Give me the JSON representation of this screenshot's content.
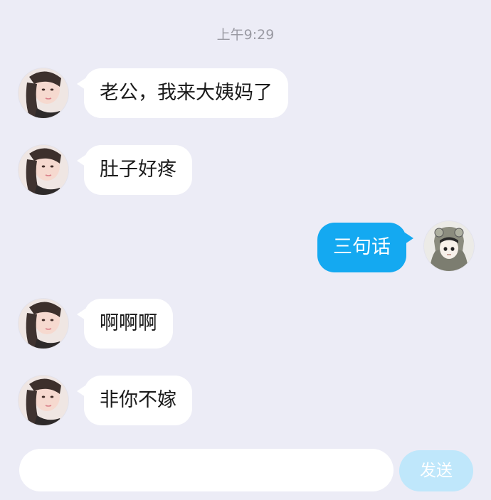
{
  "header": {
    "time": "上午9:29"
  },
  "messages": [
    {
      "side": "left",
      "text": "老公，我来大姨妈了"
    },
    {
      "side": "left",
      "text": "肚子好疼"
    },
    {
      "side": "right",
      "text": "三句话"
    },
    {
      "side": "left",
      "text": "啊啊啊"
    },
    {
      "side": "left",
      "text": "非你不嫁"
    }
  ],
  "composer": {
    "input_value": "",
    "send_label": "发送"
  },
  "colors": {
    "background": "#ececf6",
    "incoming_bubble": "#ffffff",
    "outgoing_bubble": "#14a9f1",
    "send_button_disabled": "#bfe7fb"
  }
}
